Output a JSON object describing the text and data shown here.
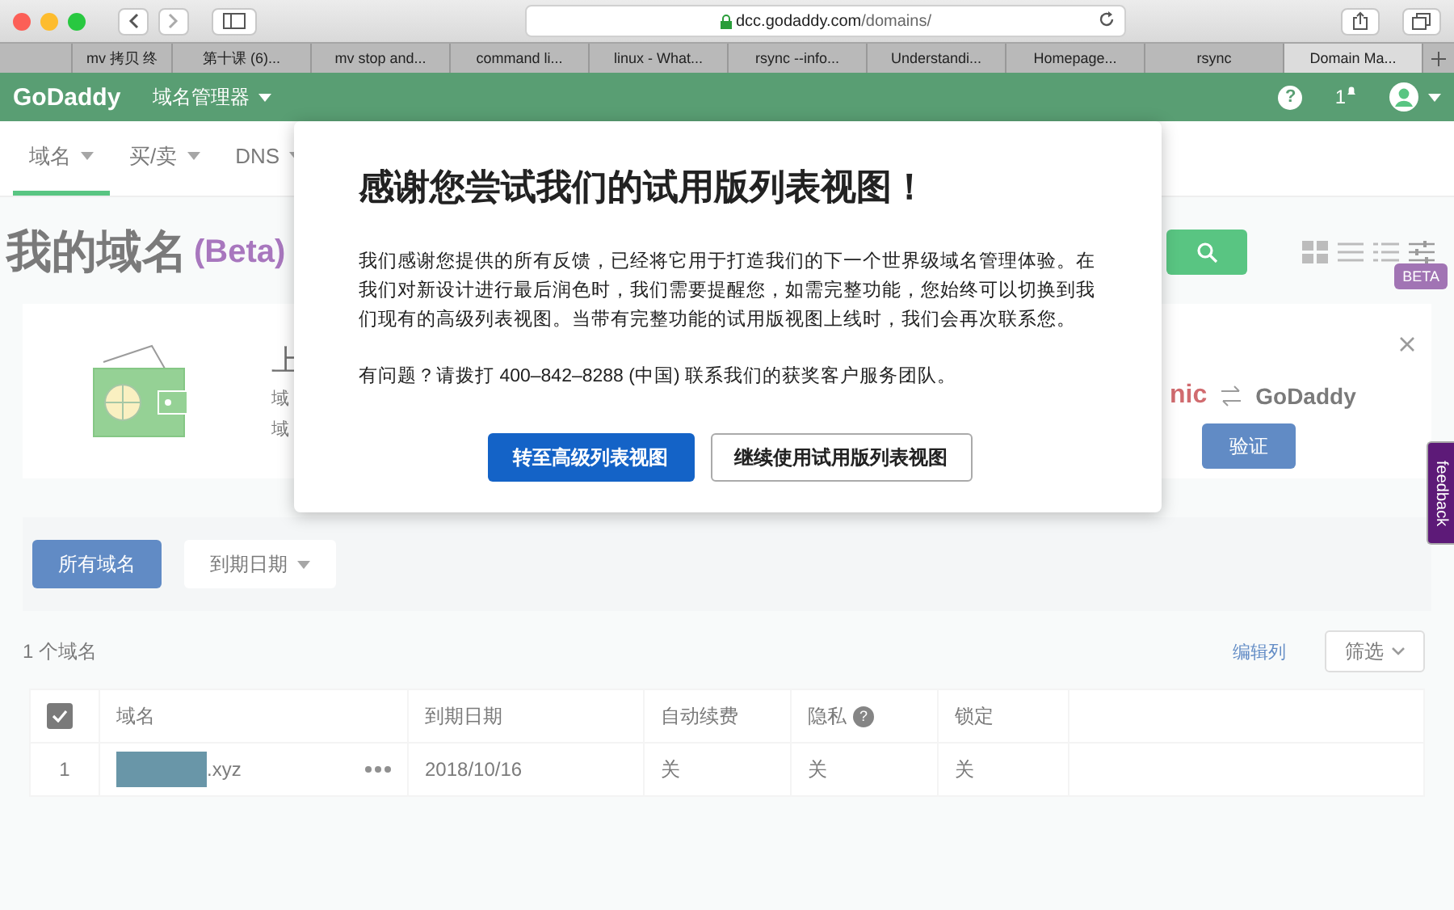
{
  "browser": {
    "url_host": "dcc.godaddy.com",
    "url_path": "/domains/",
    "tabs": [
      {
        "label": "mv 拷贝 终",
        "selected": false
      },
      {
        "label": "第十课 (6)...",
        "selected": false
      },
      {
        "label": "mv stop and...",
        "selected": false
      },
      {
        "label": "command li...",
        "selected": false
      },
      {
        "label": "linux - What...",
        "selected": false
      },
      {
        "label": "rsync --info...",
        "selected": false
      },
      {
        "label": "Understandi...",
        "selected": false
      },
      {
        "label": "Homepage...",
        "selected": false
      },
      {
        "label": "rsync",
        "selected": false
      },
      {
        "label": "Domain Ma...",
        "selected": true
      }
    ]
  },
  "header": {
    "logo": "GoDaddy",
    "menu": "域名管理器",
    "help_icon": "?",
    "notification_count": "1"
  },
  "nav": [
    {
      "label": "域名",
      "selected": true
    },
    {
      "label": "买/卖",
      "selected": false
    },
    {
      "label": "DNS",
      "selected": false
    }
  ],
  "page_title": "我的域名",
  "page_title_suffix": "(Beta)",
  "beta_badge": "BETA",
  "banner": {
    "fragments": [
      "上",
      "域",
      "域"
    ],
    "partner_text": "nic",
    "brand": "GoDaddy",
    "verify_button": "验证"
  },
  "filters": [
    {
      "label": "所有域名",
      "kind": "chip"
    },
    {
      "label": "到期日期",
      "kind": "dropdown"
    }
  ],
  "count": "1 个域名",
  "edit_columns": "编辑列",
  "filter_button": "筛选",
  "table": {
    "columns": [
      "域名",
      "到期日期",
      "自动续费",
      "隐私",
      "锁定"
    ],
    "all_checked": true,
    "privacy_help_icon": "?",
    "rows": [
      {
        "index": "1",
        "domain_suffix": ".xyz",
        "expires": "2018/10/16",
        "auto_renew": "关",
        "privacy": "关",
        "lock": "关"
      }
    ]
  },
  "modal": {
    "title": "感谢您尝试我们的试用版列表视图！",
    "body": "我们感谢您提供的所有反馈，已经将它用于打造我们的下一个世界级域名管理体验。在我们对新设计进行最后润色时，我们需要提醒您，如需完整功能，您始终可以切换到我们现有的高级列表视图。当带有完整功能的试用版视图上线时，我们会再次联系您。",
    "contact": "有问题？请拨打 400–842–8288 (中国) 联系我们的获奖客户服务团队。",
    "primary_button": "转至高级列表视图",
    "secondary_button": "继续使用试用版列表视图"
  },
  "feedback": "feedback"
}
